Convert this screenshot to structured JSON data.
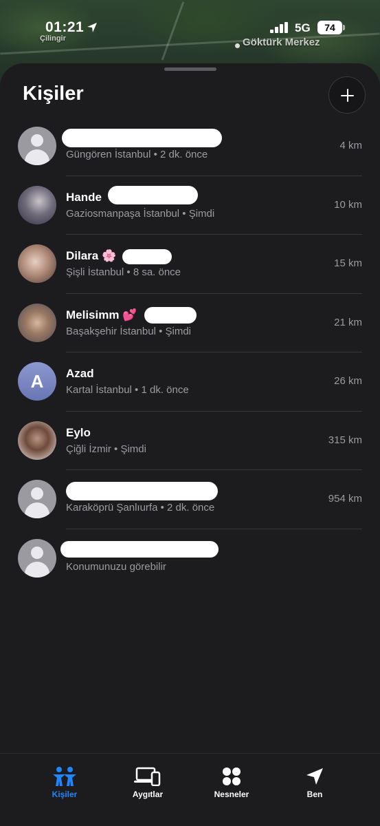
{
  "map": {
    "labels": [
      "Çilingir",
      "Göktürk Merkez"
    ]
  },
  "status_bar": {
    "time": "01:21",
    "network": "5G",
    "battery": "74"
  },
  "header": {
    "title": "Kişiler",
    "add_icon": "plus-icon"
  },
  "people": [
    {
      "name": "",
      "location": "Güngören İstanbul",
      "time": "2 dk. önce",
      "distance": "4 km",
      "avatar": "generic"
    },
    {
      "name": "Hande",
      "location": "Gaziosmanpaşa İstanbul",
      "time": "Şimdi",
      "distance": "10 km",
      "avatar": "photo"
    },
    {
      "name": "Dilara 🌸",
      "location": "Şişli İstanbul",
      "time": "8 sa. önce",
      "distance": "15 km",
      "avatar": "photo"
    },
    {
      "name": "Melisimm 💕",
      "location": "Başakşehir İstanbul",
      "time": "Şimdi",
      "distance": "21 km",
      "avatar": "photo"
    },
    {
      "name": "Azad",
      "location": "Kartal İstanbul",
      "time": "1 dk. önce",
      "distance": "26 km",
      "avatar": "letter",
      "initial": "A"
    },
    {
      "name": "Eylo",
      "location": "Çiğli İzmir",
      "time": "Şimdi",
      "distance": "315 km",
      "avatar": "photo"
    },
    {
      "name": "",
      "location": "Karaköprü Şanlıurfa",
      "time": "2 dk. önce",
      "distance": "954 km",
      "avatar": "generic"
    },
    {
      "name": "",
      "location": "Konumunuzu görebilir",
      "time": "",
      "distance": "",
      "avatar": "generic"
    }
  ],
  "tabs": [
    {
      "label": "Kişiler",
      "icon": "people-icon",
      "active": true
    },
    {
      "label": "Aygıtlar",
      "icon": "devices-icon",
      "active": false
    },
    {
      "label": "Nesneler",
      "icon": "items-icon",
      "active": false
    },
    {
      "label": "Ben",
      "icon": "location-arrow-icon",
      "active": false
    }
  ],
  "colors": {
    "accent": "#1f86ff",
    "sheet_bg": "#1c1c1e",
    "secondary_text": "#9b9ba1"
  }
}
